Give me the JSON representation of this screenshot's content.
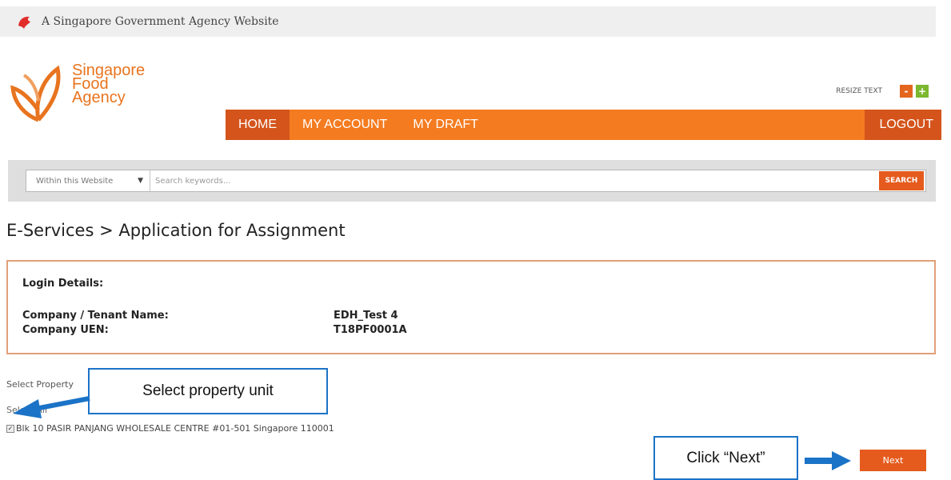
{
  "gov_banner": {
    "text": "A Singapore Government Agency Website"
  },
  "logo": {
    "line1": "Singapore",
    "line2": "Food",
    "line3": "Agency"
  },
  "resize": {
    "label": "RESIZE TEXT",
    "decrease": "-",
    "increase": "+"
  },
  "nav": {
    "home": "HOME",
    "account": "MY ACCOUNT",
    "draft": "MY DRAFT",
    "logout": "LOGOUT"
  },
  "search": {
    "scope": "Within this Website",
    "placeholder": "Search keywords...",
    "button": "SEARCH"
  },
  "page": {
    "title": "E-Services > Application for Assignment"
  },
  "login": {
    "heading": "Login Details:",
    "company_label": "Company / Tenant Name:",
    "company_value": "EDH_Test 4",
    "uen_label": "Company UEN:",
    "uen_value": "T18PF0001A"
  },
  "property": {
    "label": "Select Property",
    "select_all": "Select All",
    "unit": "Blk 10 PASIR PANJANG WHOLESALE CENTRE #01-501 Singapore 110001",
    "unit_checked": true
  },
  "annotations": {
    "select_unit": "Select property unit",
    "click_next": "Click “Next”"
  },
  "actions": {
    "next": "Next"
  },
  "colors": {
    "primary": "#f47b20",
    "accent": "#d4541b",
    "callout_border": "#1b73c7"
  }
}
